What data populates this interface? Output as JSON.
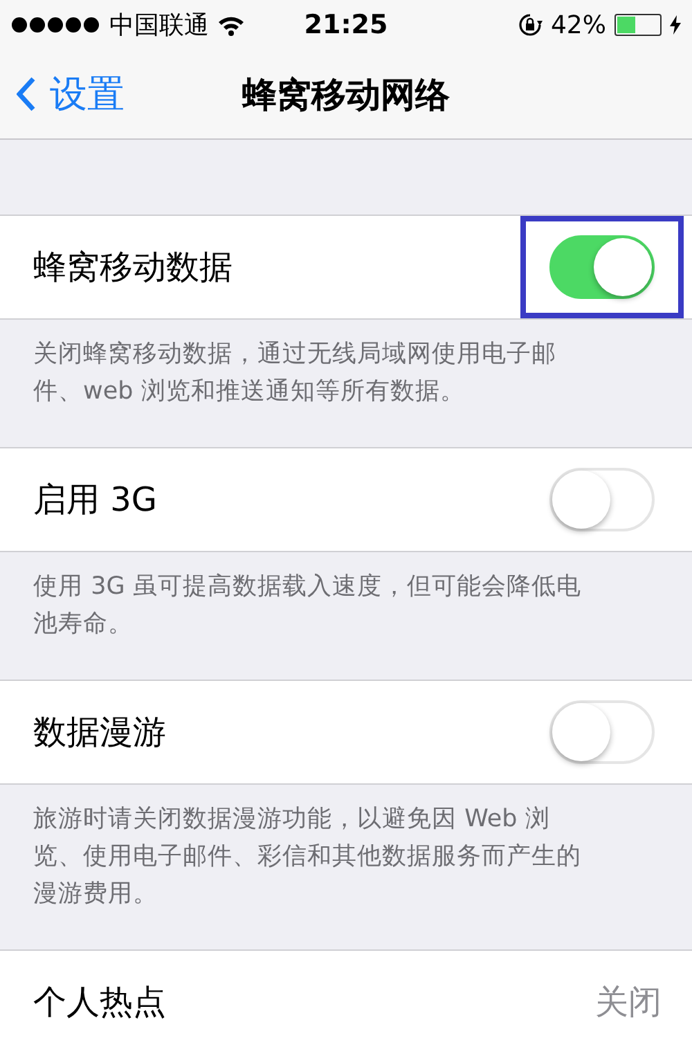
{
  "status_bar": {
    "carrier": "中国联通",
    "time": "21:25",
    "battery_percent": "42%",
    "battery": {
      "level": 0.42
    }
  },
  "nav": {
    "back": "设置",
    "title": "蜂窝移动网络"
  },
  "sections": [
    {
      "label": "蜂窝移动数据",
      "kind": "toggle",
      "on": true,
      "highlighted": true,
      "footer": "关闭蜂窝移动数据，通过无线局域网使用电子邮件、web 浏览和推送通知等所有数据。"
    },
    {
      "label": "启用 3G",
      "kind": "toggle",
      "on": false,
      "highlighted": false,
      "footer": "使用 3G 虽可提高数据载入速度，但可能会降低电池寿命。"
    },
    {
      "label": "数据漫游",
      "kind": "toggle",
      "on": false,
      "highlighted": false,
      "footer": "旅游时请关闭数据漫游功能，以避免因 Web 浏览、使用电子邮件、彩信和其他数据服务而产生的漫游费用。"
    },
    {
      "label": "个人热点",
      "kind": "value",
      "value": "关闭"
    }
  ]
}
